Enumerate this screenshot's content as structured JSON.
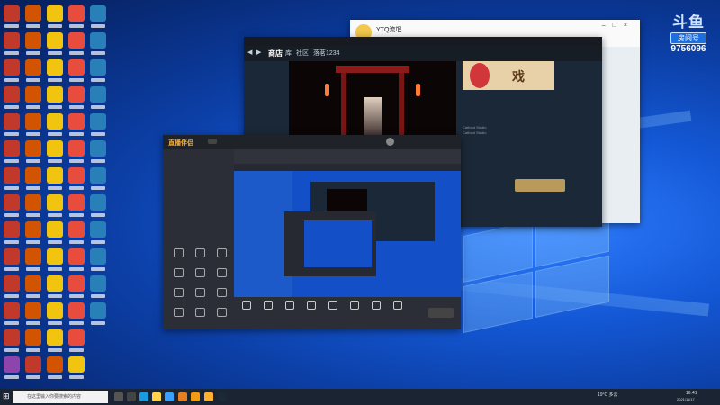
{
  "desktop": {
    "icons_count": 72
  },
  "overlay": {
    "brand_text": "斗鱼",
    "room_label": "房间号",
    "room_number": "9756096"
  },
  "chat_window": {
    "title": "YTQ流氓",
    "subtitle": "",
    "buttons": [
      "",
      "",
      ""
    ],
    "controls": [
      "–",
      "□",
      "×"
    ]
  },
  "steam_window": {
    "tabs": [
      "商店",
      "库",
      "社区",
      "落茗1234"
    ],
    "game_title": "",
    "ready_button": "",
    "dev_label": "Catfood Studio",
    "pub_label": "Catfood Studio"
  },
  "obs_window": {
    "logo": "直播伴侣",
    "tabs": [
      "",
      "",
      ""
    ],
    "stream_title": "",
    "tool_section": "",
    "bottom_tools": [
      "",
      "",
      "",
      "",
      "",
      "",
      "",
      ""
    ],
    "start_button": "",
    "sources": [
      "",
      "",
      "",
      ""
    ]
  },
  "taskbar": {
    "search_placeholder": "在这里输入你要搜索的内容",
    "weather": "19°C 多云",
    "clock_time": "16:41",
    "clock_date": "2021/11/17"
  }
}
